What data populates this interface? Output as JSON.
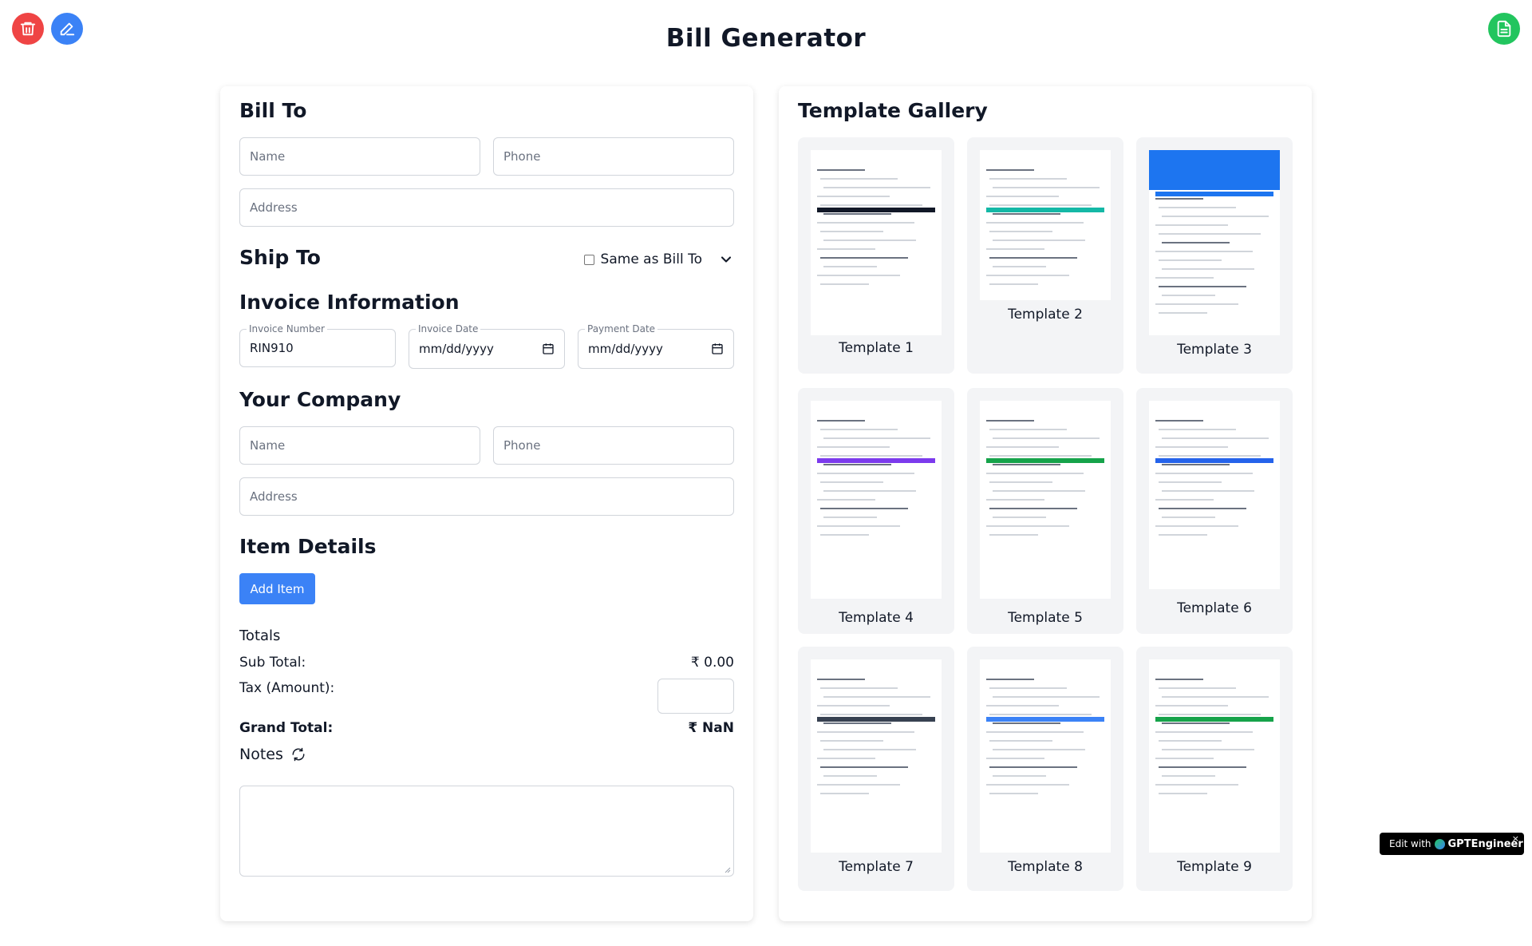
{
  "header": {
    "title": "Bill Generator",
    "delete_icon": "trash-icon",
    "edit_icon": "edit-icon",
    "doc_icon": "document-icon"
  },
  "bill_to": {
    "title": "Bill To",
    "name_placeholder": "Name",
    "phone_placeholder": "Phone",
    "address_placeholder": "Address"
  },
  "ship_to": {
    "title": "Ship To",
    "same_as_label": "Same as Bill To"
  },
  "invoice_info": {
    "title": "Invoice Information",
    "invoice_number_label": "Invoice Number",
    "invoice_number_value": "RIN910",
    "invoice_date_label": "Invoice Date",
    "invoice_date_value": "mm/dd/yyyy",
    "payment_date_label": "Payment Date",
    "payment_date_value": "mm/dd/yyyy"
  },
  "your_company": {
    "title": "Your Company",
    "name_placeholder": "Name",
    "phone_placeholder": "Phone",
    "address_placeholder": "Address"
  },
  "items": {
    "title": "Item Details",
    "add_label": "Add Item"
  },
  "totals": {
    "title": "Totals",
    "subtotal_label": "Sub Total:",
    "subtotal_value": "₹ 0.00",
    "tax_label": "Tax (Amount):",
    "grand_label": "Grand Total:",
    "grand_value": "₹ NaN"
  },
  "notes": {
    "label": "Notes"
  },
  "gallery": {
    "title": "Template Gallery",
    "templates": [
      {
        "label": "Template 1"
      },
      {
        "label": "Template 2"
      },
      {
        "label": "Template 3"
      },
      {
        "label": "Template 4"
      },
      {
        "label": "Template 5"
      },
      {
        "label": "Template 6"
      },
      {
        "label": "Template 7"
      },
      {
        "label": "Template 8"
      },
      {
        "label": "Template 9"
      }
    ],
    "accent_colors": [
      "#111827",
      "#14b8a6",
      "#1d75f0",
      "#7c3aed",
      "#16a34a",
      "#2563eb",
      "#374151",
      "#3b82f6",
      "#16a34a"
    ]
  },
  "badge": {
    "prefix": "Edit with",
    "brand": "GPTEngineer",
    "close": "×"
  }
}
